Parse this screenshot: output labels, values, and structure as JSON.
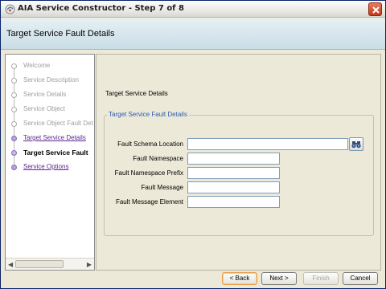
{
  "window": {
    "title": "AIA Service Constructor - Step 7 of 8"
  },
  "header": {
    "title": "Target Service Fault Details"
  },
  "nav": {
    "items": [
      {
        "label": "Welcome",
        "state": "disabled"
      },
      {
        "label": "Service Description",
        "state": "disabled"
      },
      {
        "label": "Service Details",
        "state": "disabled"
      },
      {
        "label": "Service Object",
        "state": "disabled"
      },
      {
        "label": "Service Object Fault Det",
        "state": "disabled"
      },
      {
        "label": "Target Service Details",
        "state": "visited"
      },
      {
        "label": "Target Service Fault",
        "state": "current"
      },
      {
        "label": "Service Options",
        "state": "visited"
      }
    ]
  },
  "content": {
    "section_label": "Target Service Details",
    "group_legend": "Target Service Fault Details",
    "fields": [
      {
        "label": "Fault Schema Location",
        "value": ""
      },
      {
        "label": "Fault Namespace",
        "value": ""
      },
      {
        "label": "Fault Namespace Prefix",
        "value": ""
      },
      {
        "label": "Fault Message",
        "value": ""
      },
      {
        "label": "Fault Message Element",
        "value": ""
      }
    ]
  },
  "buttons": {
    "back": "< Back",
    "next": "Next >",
    "finish": "Finish",
    "cancel": "Cancel"
  },
  "colors": {
    "accent_link": "#5a2590",
    "legend": "#2a5db0",
    "header_bg": "#c9dde6"
  },
  "icons": {
    "app": "app-icon",
    "close": "close-icon",
    "browse": "binoculars-icon"
  }
}
